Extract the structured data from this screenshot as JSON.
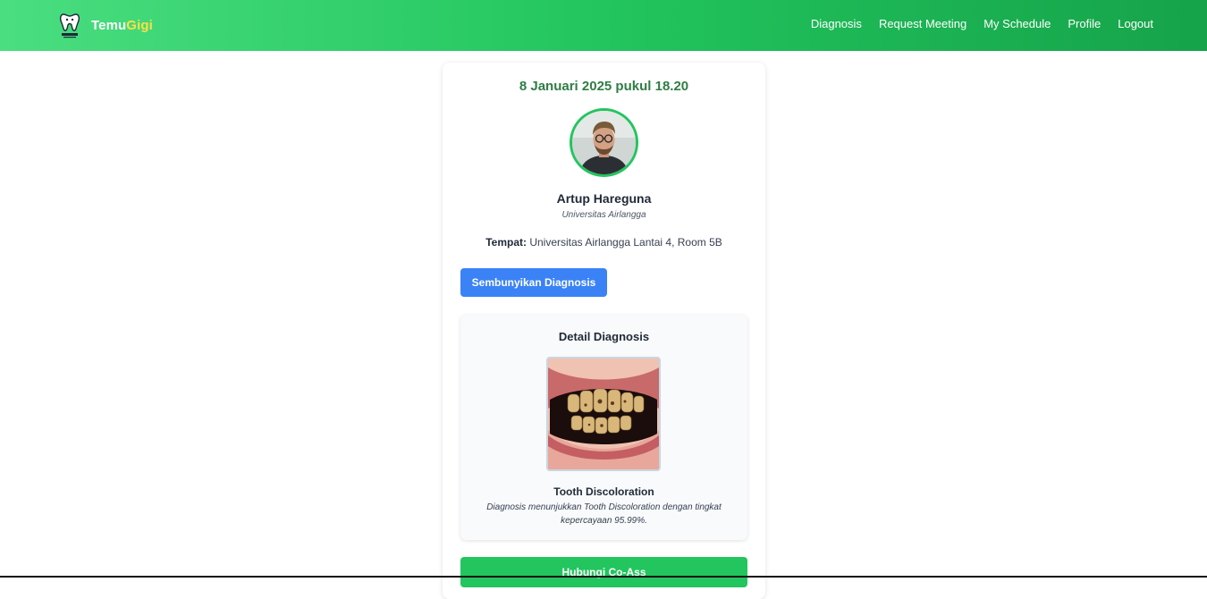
{
  "navbar": {
    "brand_main": "Temu",
    "brand_accent": "Gigi",
    "logo_icon": "tooth-logo-icon",
    "links": [
      "Diagnosis",
      "Request Meeting",
      "My Schedule",
      "Profile",
      "Logout"
    ]
  },
  "appointment": {
    "datetime": "8 Januari 2025 pukul 18.20",
    "coass_name": "Artup Hareguna",
    "university": "Universitas Airlangga",
    "place_label": "Tempat:",
    "place_value": "Universitas Airlangga Lantai 4, Room 5B",
    "toggle_button": "Sembunyikan Diagnosis"
  },
  "diagnosis": {
    "section_title": "Detail Diagnosis",
    "condition": "Tooth Discoloration",
    "description": "Diagnosis menunjukkan Tooth Discoloration dengan tingkat kepercayaan 95.99%."
  },
  "contact_button": "Hubungi Co-Ass",
  "colors": {
    "nav_start": "#4ade80",
    "nav_end": "#16a34a",
    "brand_accent": "#fde047",
    "date_text": "#2f7d45",
    "primary_button": "#3b82f6",
    "contact_button": "#22c55e"
  }
}
